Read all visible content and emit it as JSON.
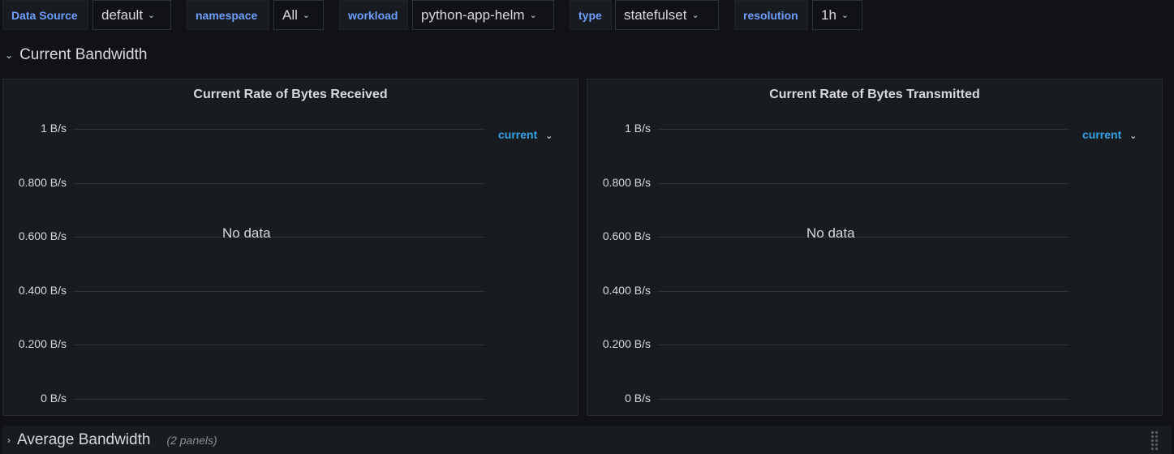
{
  "variables": [
    {
      "label": "Data Source",
      "value": "default"
    },
    {
      "label": "namespace",
      "value": "All"
    },
    {
      "label": "workload",
      "value": "python-app-helm"
    },
    {
      "label": "type",
      "value": "statefulset"
    },
    {
      "label": "resolution",
      "value": "1h"
    }
  ],
  "icons": {
    "chevron": "chevron-down-icon",
    "expand": "chevron-right-icon",
    "drag": "drag-handle-icon"
  },
  "rows": {
    "current": {
      "title": "Current Bandwidth"
    },
    "average": {
      "title": "Average Bandwidth",
      "count": "(2 panels)"
    }
  },
  "panels": [
    {
      "title": "Current Rate of Bytes Received",
      "empty_text": "No data",
      "legend_sort": "current"
    },
    {
      "title": "Current Rate of Bytes Transmitted",
      "empty_text": "No data",
      "legend_sort": "current"
    }
  ],
  "chart_data": [
    {
      "type": "line",
      "title": "Current Rate of Bytes Received",
      "series": [],
      "ylim": [
        0,
        1
      ],
      "yticks": [
        "1 B/s",
        "0.800 B/s",
        "0.600 B/s",
        "0.400 B/s",
        "0.200 B/s",
        "0 B/s"
      ],
      "grid": true
    },
    {
      "type": "line",
      "title": "Current Rate of Bytes Transmitted",
      "series": [],
      "ylim": [
        0,
        1
      ],
      "yticks": [
        "1 B/s",
        "0.800 B/s",
        "0.600 B/s",
        "0.400 B/s",
        "0.200 B/s",
        "0 B/s"
      ],
      "grid": true
    }
  ],
  "colors": {
    "background": "#111217",
    "panel": "#181b1f",
    "accent": "#33a2e5",
    "label": "#6e9fff"
  }
}
